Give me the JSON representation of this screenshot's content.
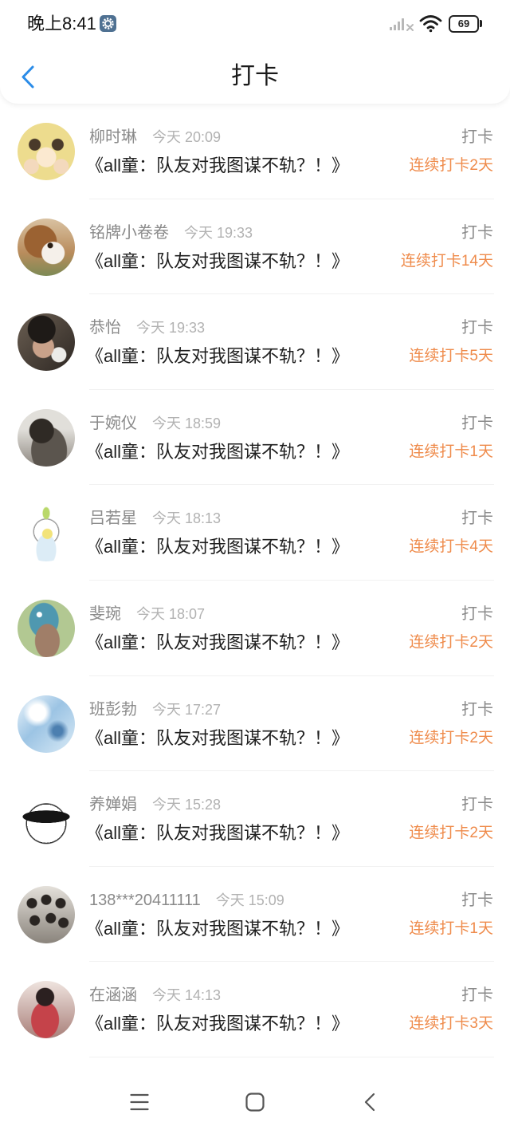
{
  "status_bar": {
    "time": "晚上8:41",
    "battery": "69",
    "icons": {
      "badge": "settings-badge-icon",
      "signal": "signal-icon",
      "wifi": "wifi-icon",
      "battery": "battery-icon"
    }
  },
  "header": {
    "back_icon": "chevron-left-icon",
    "title": "打卡"
  },
  "checkins": [
    {
      "name": "柳时琳",
      "time": "今天 20:09",
      "action": "打卡",
      "book": "《all童：队友对我图谋不轨？！》",
      "streak": "连续打卡2天",
      "avatar_color": "#eddc8e"
    },
    {
      "name": "铭牌小卷卷",
      "time": "今天 19:33",
      "action": "打卡",
      "book": "《all童：队友对我图谋不轨？！》",
      "streak": "连续打卡14天",
      "avatar_color": "#c8a47c"
    },
    {
      "name": "恭怡",
      "time": "今天 19:33",
      "action": "打卡",
      "book": "《all童：队友对我图谋不轨？！》",
      "streak": "连续打卡5天",
      "avatar_color": "#4a4038"
    },
    {
      "name": "于婉仪",
      "time": "今天 18:59",
      "action": "打卡",
      "book": "《all童：队友对我图谋不轨？！》",
      "streak": "连续打卡1天",
      "avatar_color": "#9a9690"
    },
    {
      "name": "吕若星",
      "time": "今天 18:13",
      "action": "打卡",
      "book": "《all童：队友对我图谋不轨？！》",
      "streak": "连续打卡4天",
      "avatar_color": "#ffffff"
    },
    {
      "name": "斐琬",
      "time": "今天 18:07",
      "action": "打卡",
      "book": "《all童：队友对我图谋不轨？！》",
      "streak": "连续打卡2天",
      "avatar_color": "#b2c892"
    },
    {
      "name": "班彭勃",
      "time": "今天 17:27",
      "action": "打卡",
      "book": "《all童：队友对我图谋不轨？！》",
      "streak": "连续打卡2天",
      "avatar_color": "#cfe3f2"
    },
    {
      "name": "养婵娟",
      "time": "今天 15:28",
      "action": "打卡",
      "book": "《all童：队友对我图谋不轨？！》",
      "streak": "连续打卡2天",
      "avatar_color": "#ffffff"
    },
    {
      "name": "138***20411111",
      "time": "今天 15:09",
      "action": "打卡",
      "book": "《all童：队友对我图谋不轨？！》",
      "streak": "连续打卡1天",
      "avatar_color": "#c7c1b9"
    },
    {
      "name": "在涵涵",
      "time": "今天 14:13",
      "action": "打卡",
      "book": "《all童：队友对我图谋不轨？！》",
      "streak": "连续打卡3天",
      "avatar_color": "#d9b3ad"
    }
  ],
  "nav_bar": {
    "icons": {
      "menu": "menu-icon",
      "home": "home-icon",
      "back": "back-icon"
    }
  },
  "colors": {
    "accent": "#2b8ce8",
    "streak": "#ef8b4b",
    "secondary_text": "#8a8a8a",
    "primary_text": "#1f1f1f"
  }
}
